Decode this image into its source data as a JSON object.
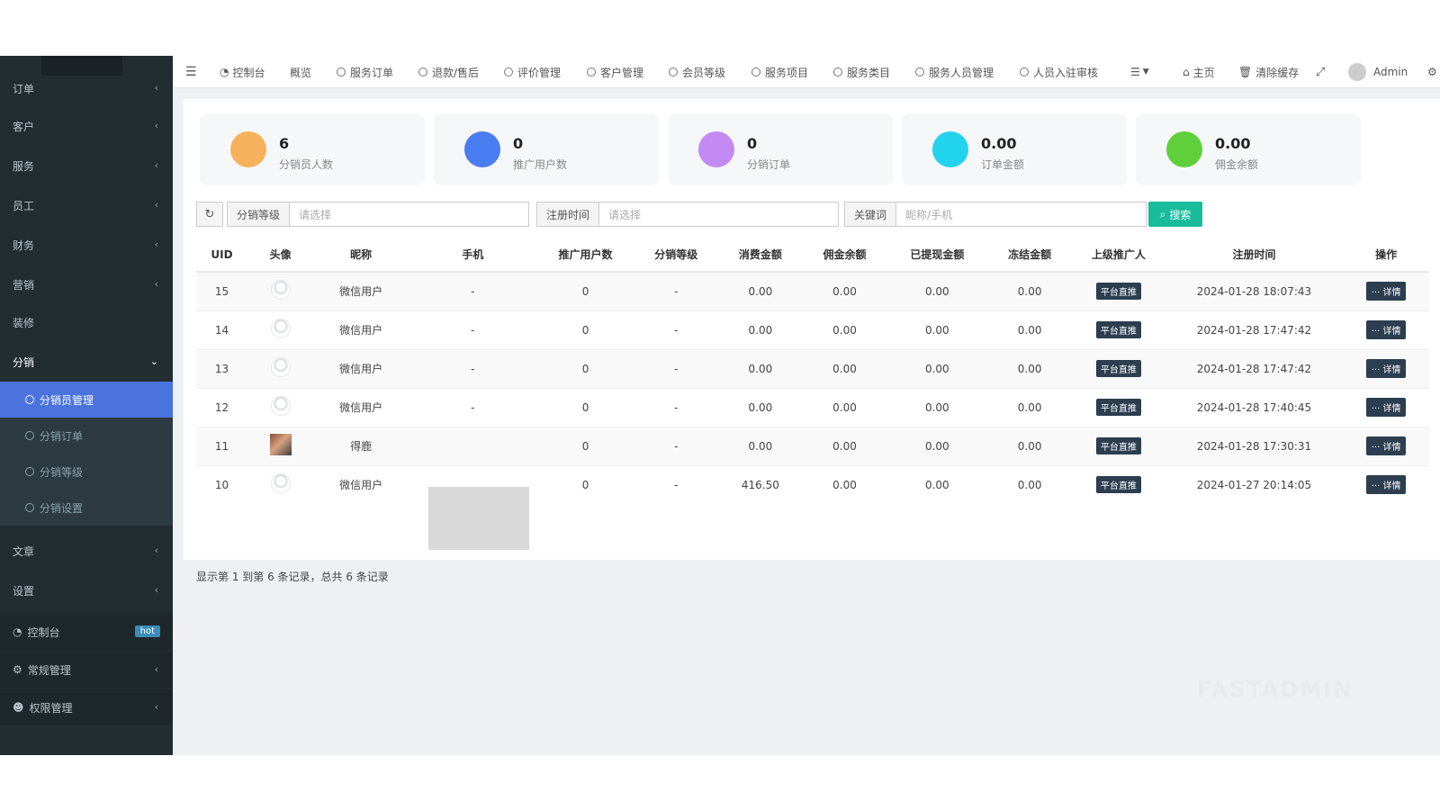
{
  "sidebar": {
    "items": [
      {
        "label": "订单",
        "caret": "‹"
      },
      {
        "label": "客户",
        "caret": "‹"
      },
      {
        "label": "服务",
        "caret": "‹"
      },
      {
        "label": "员工",
        "caret": "‹"
      },
      {
        "label": "财务",
        "caret": "‹"
      },
      {
        "label": "营销",
        "caret": "‹"
      },
      {
        "label": "装修",
        "caret": ""
      },
      {
        "label": "分销",
        "caret": "⌄"
      }
    ],
    "sub_items": [
      {
        "label": "分销员管理"
      },
      {
        "label": "分销订单"
      },
      {
        "label": "分销等级"
      },
      {
        "label": "分销设置"
      }
    ],
    "items2": [
      {
        "label": "文章",
        "caret": "‹"
      },
      {
        "label": "设置",
        "caret": "‹"
      }
    ],
    "bottom": [
      {
        "label": "控制台",
        "badge": "hot",
        "icon": "dashboard-icon"
      },
      {
        "label": "常规管理",
        "caret": "‹",
        "icon": "cogs-icon"
      },
      {
        "label": "权限管理",
        "caret": "‹",
        "icon": "users-icon"
      }
    ]
  },
  "topbar": {
    "menu_icon": "☰",
    "tabs": [
      {
        "label": "控制台",
        "icon": "dashboard-icon"
      },
      {
        "label": "概览"
      },
      {
        "label": "服务订单"
      },
      {
        "label": "退款/售后"
      },
      {
        "label": "评价管理"
      },
      {
        "label": "客户管理"
      },
      {
        "label": "会员等级"
      },
      {
        "label": "服务项目"
      },
      {
        "label": "服务类目"
      },
      {
        "label": "服务人员管理"
      },
      {
        "label": "人员入驻审核"
      }
    ],
    "right": {
      "home": "主页",
      "clear_cache": "清除缓存",
      "user": "Admin"
    }
  },
  "stats": [
    {
      "value": "6",
      "label": "分销员人数",
      "color": "#f7b15c"
    },
    {
      "value": "0",
      "label": "推广用户数",
      "color": "#4a7cf2"
    },
    {
      "value": "0",
      "label": "分销订单",
      "color": "#c28af2"
    },
    {
      "value": "0.00",
      "label": "订单金额",
      "color": "#22d3ee"
    },
    {
      "value": "0.00",
      "label": "佣金余额",
      "color": "#5fd03a"
    }
  ],
  "filters": {
    "level_label": "分销等级",
    "level_placeholder": "请选择",
    "time_label": "注册时间",
    "time_placeholder": "请选择",
    "keyword_label": "关键词",
    "keyword_placeholder": "昵称/手机",
    "search_label": "搜索"
  },
  "table": {
    "headers": [
      "UID",
      "头像",
      "昵称",
      "手机",
      "推广用户数",
      "分销等级",
      "消费金额",
      "佣金余额",
      "已提现金额",
      "冻结金额",
      "上级推广人",
      "注册时间",
      "操作"
    ],
    "rows": [
      {
        "uid": "15",
        "avatar": "default",
        "nickname": "微信用户",
        "phone": "-",
        "promo": "0",
        "level": "-",
        "spend": "0.00",
        "commission": "0.00",
        "withdrawn": "0.00",
        "frozen": "0.00",
        "parent": "平台直推",
        "reg_time": "2024-01-28 18:07:43",
        "action": "··· 详情"
      },
      {
        "uid": "14",
        "avatar": "default",
        "nickname": "微信用户",
        "phone": "-",
        "promo": "0",
        "level": "-",
        "spend": "0.00",
        "commission": "0.00",
        "withdrawn": "0.00",
        "frozen": "0.00",
        "parent": "平台直推",
        "reg_time": "2024-01-28 17:47:42",
        "action": "··· 详情"
      },
      {
        "uid": "13",
        "avatar": "default",
        "nickname": "微信用户",
        "phone": "-",
        "promo": "0",
        "level": "-",
        "spend": "0.00",
        "commission": "0.00",
        "withdrawn": "0.00",
        "frozen": "0.00",
        "parent": "平台直推",
        "reg_time": "2024-01-28 17:47:42",
        "action": "··· 详情"
      },
      {
        "uid": "12",
        "avatar": "default",
        "nickname": "微信用户",
        "phone": "-",
        "promo": "0",
        "level": "-",
        "spend": "0.00",
        "commission": "0.00",
        "withdrawn": "0.00",
        "frozen": "0.00",
        "parent": "平台直推",
        "reg_time": "2024-01-28 17:40:45",
        "action": "··· 详情"
      },
      {
        "uid": "11",
        "avatar": "photo",
        "nickname": "得鹿",
        "phone": "",
        "promo": "0",
        "level": "-",
        "spend": "0.00",
        "commission": "0.00",
        "withdrawn": "0.00",
        "frozen": "0.00",
        "parent": "平台直推",
        "reg_time": "2024-01-28 17:30:31",
        "action": "··· 详情"
      },
      {
        "uid": "10",
        "avatar": "default",
        "nickname": "微信用户",
        "phone": "",
        "promo": "0",
        "level": "-",
        "spend": "416.50",
        "commission": "0.00",
        "withdrawn": "0.00",
        "frozen": "0.00",
        "parent": "平台直推",
        "reg_time": "2024-01-27 20:14:05",
        "action": "··· 详情"
      }
    ]
  },
  "pager": {
    "summary": "显示第 1 到第 6 条记录，总共 6 条记录"
  },
  "watermark": "FASTADMIN"
}
